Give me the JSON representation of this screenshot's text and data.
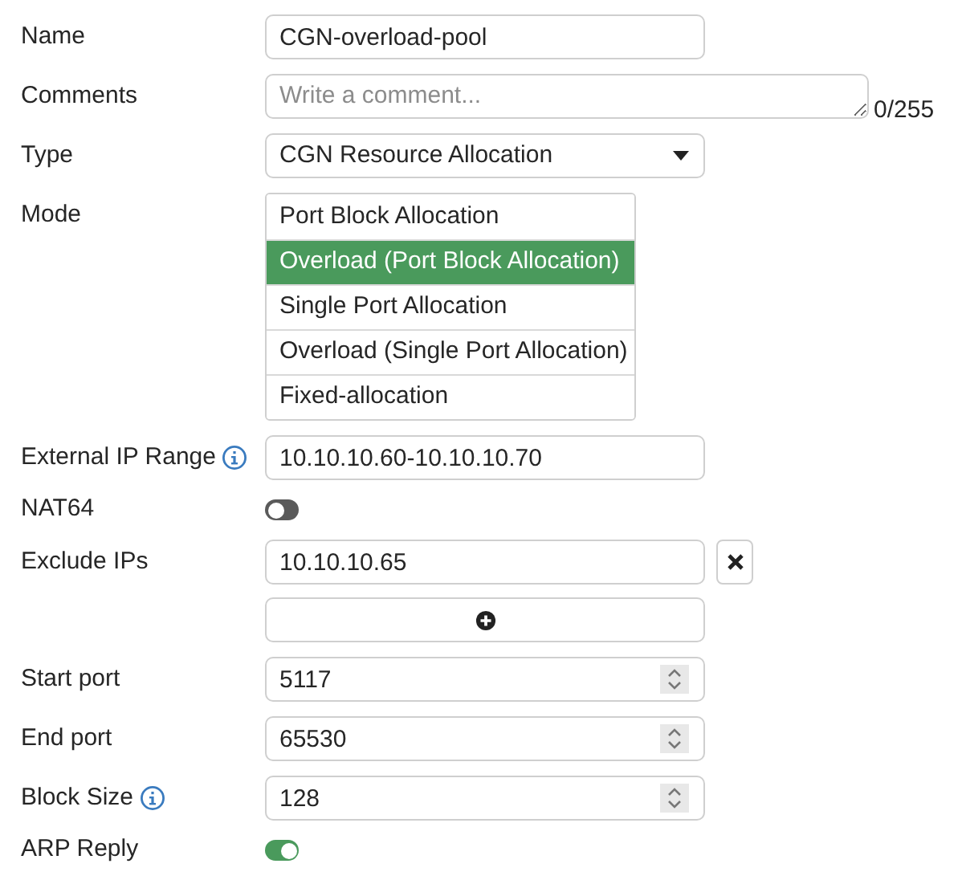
{
  "fields": [
    {
      "kind": "text",
      "label": "Name",
      "value": "CGN-overload-pool"
    },
    {
      "kind": "textarea",
      "label": "Comments",
      "placeholder": "Write a comment...",
      "counter": "0/255"
    },
    {
      "kind": "select",
      "label": "Type",
      "value": "CGN Resource Allocation"
    },
    {
      "kind": "list",
      "label": "Mode",
      "options": [
        {
          "label": "Port Block Allocation",
          "selected": false
        },
        {
          "label": "Overload (Port Block Allocation)",
          "selected": true
        },
        {
          "label": "Single Port Allocation",
          "selected": false
        },
        {
          "label": "Overload (Single Port Allocation)",
          "selected": false
        },
        {
          "label": "Fixed-allocation",
          "selected": false
        }
      ]
    },
    {
      "kind": "text",
      "label": "External IP Range",
      "info": true,
      "value": "10.10.10.60-10.10.10.70"
    },
    {
      "kind": "toggle",
      "label": "NAT64",
      "on": false
    },
    {
      "kind": "multi",
      "label": "Exclude IPs",
      "values": [
        "10.10.10.65"
      ]
    },
    {
      "kind": "number",
      "label": "Start port",
      "value": "5117"
    },
    {
      "kind": "number",
      "label": "End port",
      "value": "65530"
    },
    {
      "kind": "number",
      "label": "Block Size",
      "info": true,
      "value": "128"
    },
    {
      "kind": "toggle",
      "label": "ARP Reply",
      "on": true
    }
  ]
}
